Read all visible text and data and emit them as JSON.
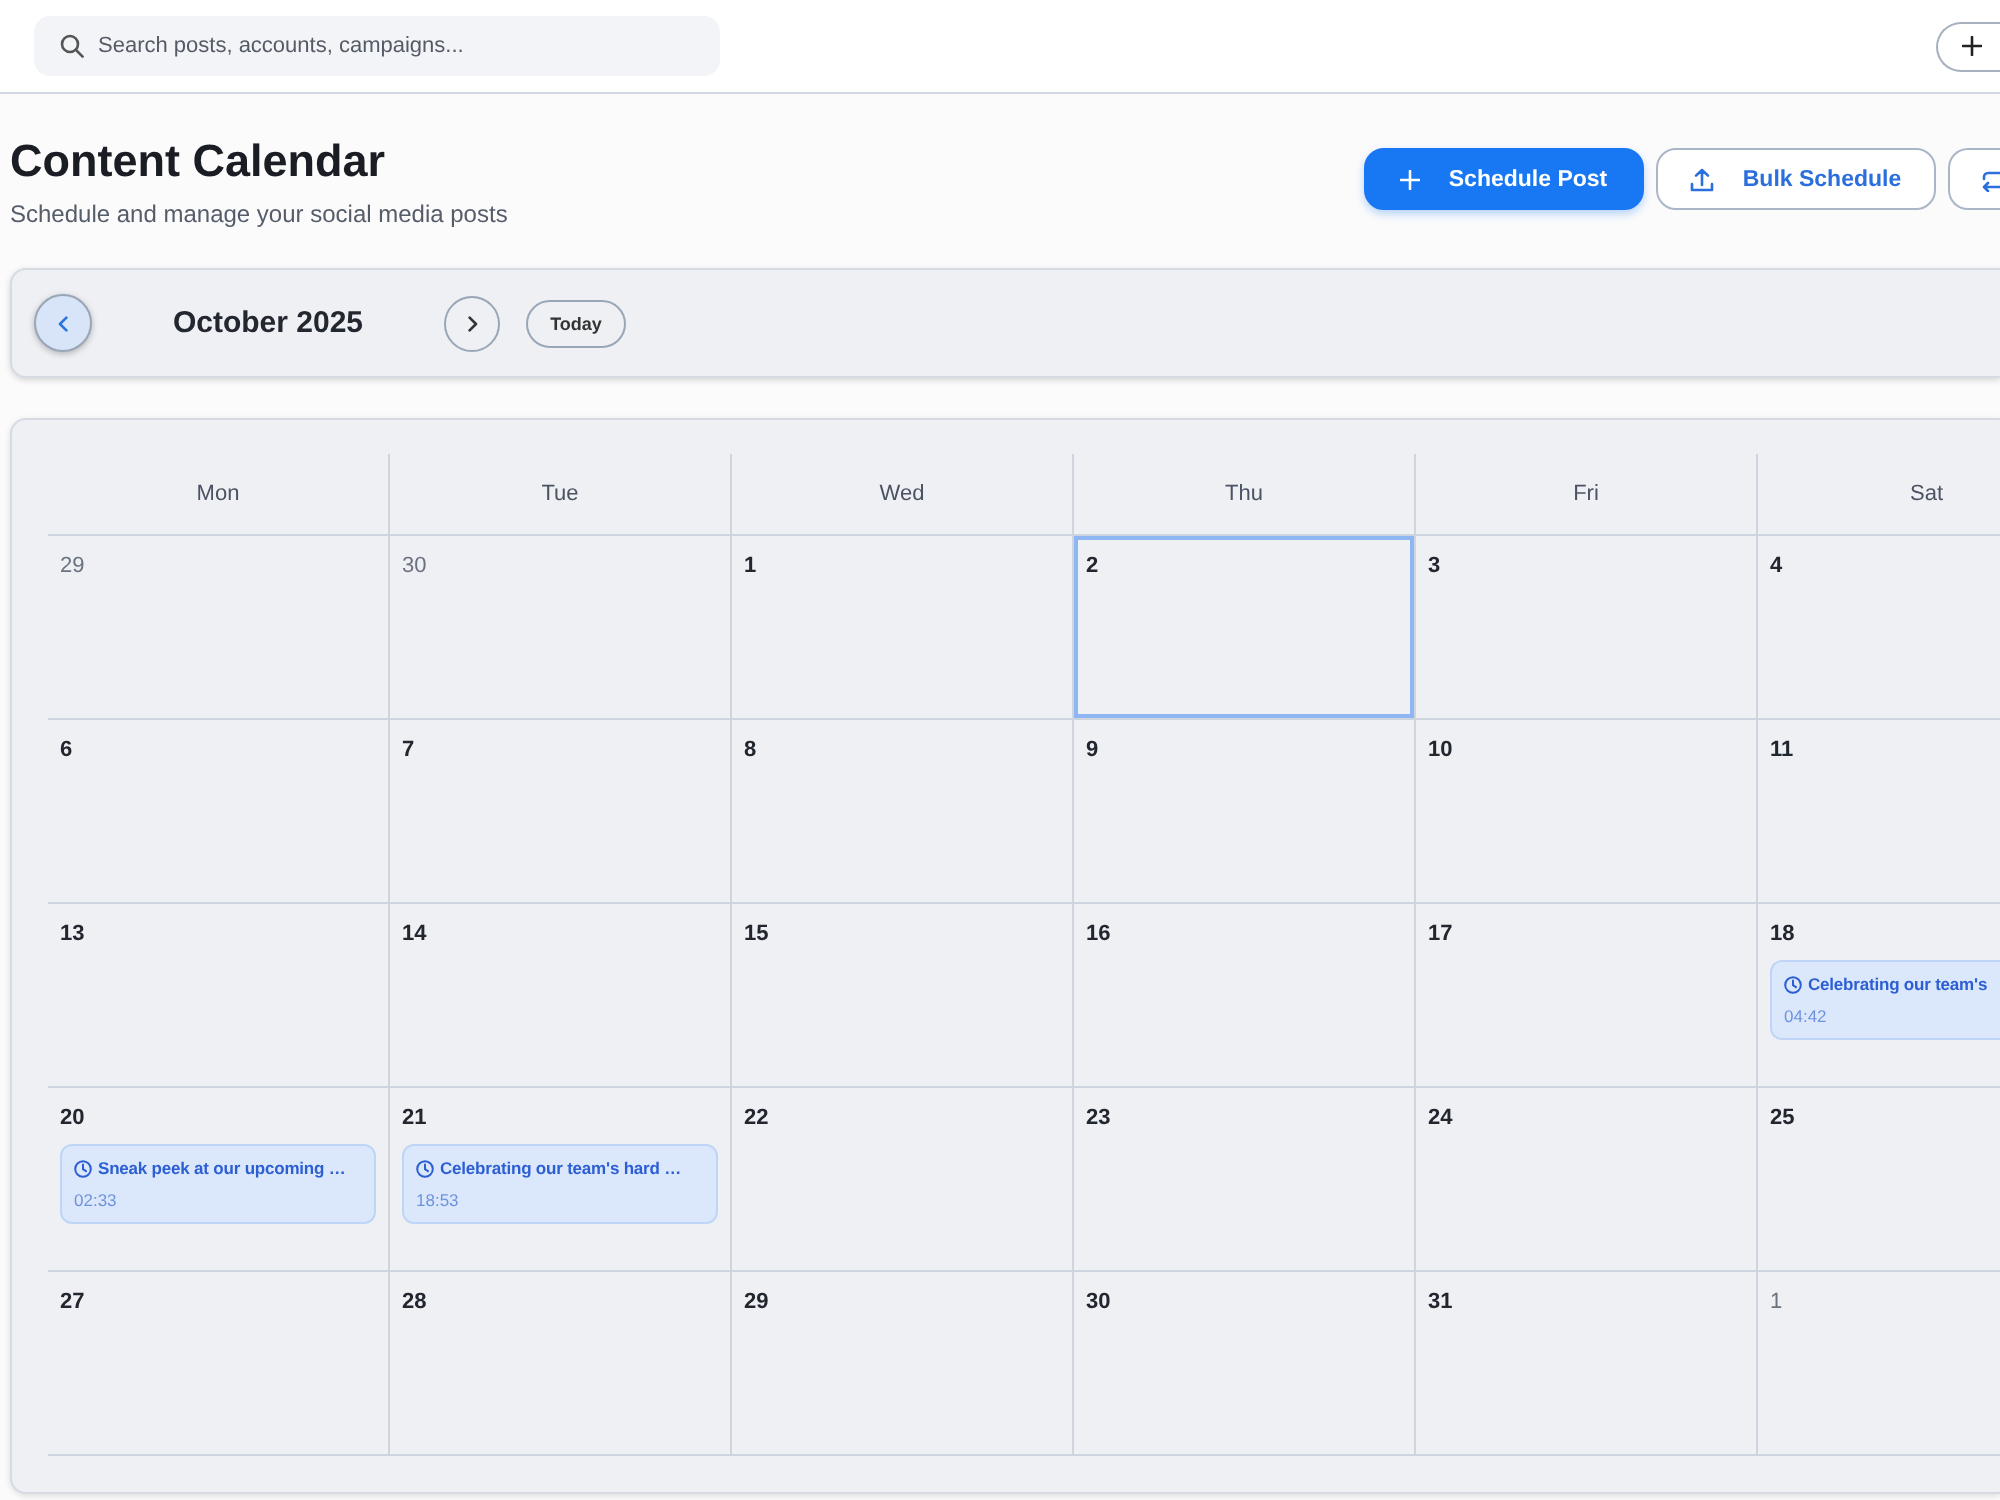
{
  "top_bar": {
    "search": {
      "placeholder": "Search posts, accounts, campaigns..."
    }
  },
  "header": {
    "title": "Content Calendar",
    "subtitle": "Schedule and manage your social media posts",
    "buttons": [
      {
        "label": "Schedule Post",
        "kind": "primary"
      },
      {
        "label": "Bulk Schedule",
        "kind": "secondary"
      }
    ]
  },
  "toolbar": {
    "month": "October 2025",
    "today_button": "Today"
  },
  "calendar": {
    "weekdays": [
      "Mon",
      "Tue",
      "Wed",
      "Thu",
      "Fri",
      "Sat"
    ],
    "weeks": [
      {
        "days": [
          {
            "day": "29",
            "outside_month": true,
            "selected": false
          },
          {
            "day": "30",
            "outside_month": true,
            "selected": false
          },
          {
            "day": "1",
            "outside_month": false,
            "selected": false
          },
          {
            "day": "2",
            "outside_month": false,
            "selected": true
          },
          {
            "day": "3",
            "outside_month": false,
            "selected": false
          },
          {
            "day": "4",
            "outside_month": false,
            "selected": false
          }
        ]
      },
      {
        "days": [
          {
            "day": "6",
            "outside_month": false,
            "selected": false
          },
          {
            "day": "7",
            "outside_month": false,
            "selected": false
          },
          {
            "day": "8",
            "outside_month": false,
            "selected": false
          },
          {
            "day": "9",
            "outside_month": false,
            "selected": false
          },
          {
            "day": "10",
            "outside_month": false,
            "selected": false
          },
          {
            "day": "11",
            "outside_month": false,
            "selected": false
          }
        ]
      },
      {
        "days": [
          {
            "day": "13",
            "outside_month": false,
            "selected": false
          },
          {
            "day": "14",
            "outside_month": false,
            "selected": false
          },
          {
            "day": "15",
            "outside_month": false,
            "selected": false
          },
          {
            "day": "16",
            "outside_month": false,
            "selected": false
          },
          {
            "day": "17",
            "outside_month": false,
            "selected": false
          },
          {
            "day": "18",
            "outside_month": false,
            "selected": false,
            "events": [
              {
                "title": "Celebrating our team's",
                "time": "04:42"
              }
            ]
          }
        ]
      },
      {
        "days": [
          {
            "day": "20",
            "outside_month": false,
            "selected": false,
            "events": [
              {
                "title": "Sneak peek at our upcoming …",
                "time": "02:33"
              }
            ]
          },
          {
            "day": "21",
            "outside_month": false,
            "selected": false,
            "events": [
              {
                "title": "Celebrating our team's hard …",
                "time": "18:53"
              }
            ]
          },
          {
            "day": "22",
            "outside_month": false,
            "selected": false
          },
          {
            "day": "23",
            "outside_month": false,
            "selected": false
          },
          {
            "day": "24",
            "outside_month": false,
            "selected": false
          },
          {
            "day": "25",
            "outside_month": false,
            "selected": false
          }
        ]
      },
      {
        "days": [
          {
            "day": "27",
            "outside_month": false,
            "selected": false
          },
          {
            "day": "28",
            "outside_month": false,
            "selected": false
          },
          {
            "day": "29",
            "outside_month": false,
            "selected": false
          },
          {
            "day": "30",
            "outside_month": false,
            "selected": false
          },
          {
            "day": "31",
            "outside_month": false,
            "selected": false
          },
          {
            "day": "1",
            "outside_month": true,
            "selected": false
          }
        ]
      }
    ]
  }
}
